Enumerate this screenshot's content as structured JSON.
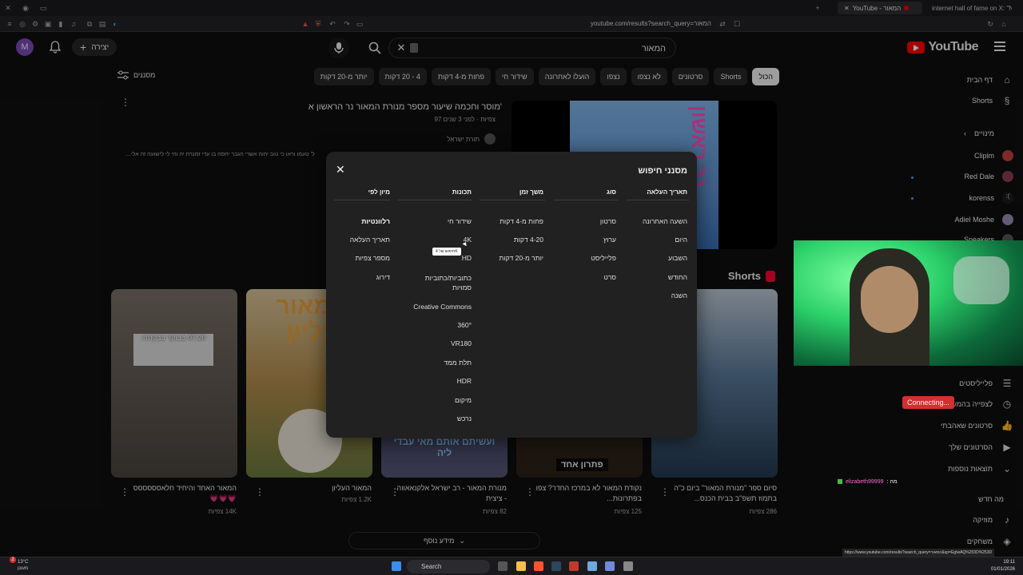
{
  "browser": {
    "tabs": [
      {
        "label": "YouTube - המאור"
      },
      {
        "label": "internet hall of fame on X: \"Ned Luk"
      }
    ],
    "url": "youtube.com/results?search_query=המאור"
  },
  "header": {
    "logo_text": "YouTube",
    "search_value": "המאור",
    "create_label": "יצירה",
    "avatar_letter": "M"
  },
  "chips": [
    "הכול",
    "Shorts",
    "סרטונים",
    "לא נצפו",
    "נצפו",
    "הועלו לאחרונה",
    "שידור חי",
    "פחות מ-4 דקות",
    "4 - 20 דקות",
    "יותר מ-20 דקות"
  ],
  "filters_label": "מסננים",
  "sidebar": {
    "home": "דף הבית",
    "shorts": "Shorts",
    "subs_header": "מינויים",
    "subs": [
      "Clipim",
      "Red Dale",
      "korenss",
      "Adiel Moshe",
      "Speakers"
    ],
    "playlists": "פלייליסטים",
    "watch_later": "לצפייה בהמשך",
    "liked": "סרטונים שאהבתי",
    "your_videos": "הסרטונים שלך",
    "more": "תוצאות נוספות",
    "whats_new": "מה חדש",
    "music": "מוזיקה",
    "games": "משחקים"
  },
  "result": {
    "title": "מוסר וחכמה שיעור מספר מנורת המאור נר הראשון א'",
    "meta": "97 צפיות · לפני 3 שנים",
    "channel": "תורת ישראל",
    "desc": "...ל' טעמו וראו כי טוב יהוה אשרי הגבר יחסה בו עדי זמנרת יה והי לי לישועה זה אלי",
    "thumb_text": "נר ראשון"
  },
  "shorts": {
    "header": "Shorts",
    "items": [
      {
        "title": "סיום ספר \"מנורת המאור\" ביום כ\"ה בתמוז תשפ\"ב בבית הכנס...",
        "views": "286 צפיות"
      },
      {
        "title": "נקודת המאור לא במרכז החדר? צפו בפתרונות...",
        "views": "125 צפיות",
        "overlay": "פתרון אחד"
      },
      {
        "title": "מנורת המאור - רב ישראל אלקנאאווה - ציצית",
        "views": "82 צפיות",
        "overlay": "ועשיתם אותם מאי עבדי ליה"
      },
      {
        "title": "המאור העליון",
        "views": "1.2K צפיות",
        "overlay": "המאור עליון"
      },
      {
        "title": "המאור האחד והיחיד חלאסססססס 💗💗💗",
        "views": "14K צפיות",
        "overlay": "07:20 בבוקר בבקתה:"
      }
    ]
  },
  "more_label": "מידע נוסף",
  "modal": {
    "title": "מסנני חיפוש",
    "columns": [
      {
        "header": "תאריך העלאה",
        "options": [
          "השעה האחרונה",
          "היום",
          "השבוע",
          "החודש",
          "השנה"
        ]
      },
      {
        "header": "סוג",
        "options": [
          "סרטון",
          "ערוץ",
          "פלייליסט",
          "סרט"
        ]
      },
      {
        "header": "משך זמן",
        "options": [
          "פחות מ-4 דקות",
          "4-20 דקות",
          "יותר מ-20 דקות"
        ]
      },
      {
        "header": "תכונות",
        "options": [
          "שידור חי",
          "4K",
          "HD",
          "כתוביות/כתוביות סמויות",
          "Creative Commons",
          "360°",
          "VR180",
          "תלת ממד",
          "HDR",
          "מיקום",
          "נרכש"
        ]
      },
      {
        "header": "מיון לפי",
        "options": [
          "רלוונטיות",
          "תאריך העלאה",
          "מספר צפיות",
          "דירוג"
        ]
      }
    ],
    "tooltip": "חיפוש של 4K"
  },
  "stream": {
    "connecting": "Connecting...",
    "chat_user": "elizabeth99999",
    "chat_msg": ": מה"
  },
  "taskbar": {
    "search": "Search",
    "time": "19:11",
    "date": "01/01/2026",
    "weather_temp": "13°C",
    "weather_desc": "מעונן"
  },
  "status_url": "https://www.youtube.com/results?search_query=המאור&sp=EgIwAQ%253D%253D"
}
